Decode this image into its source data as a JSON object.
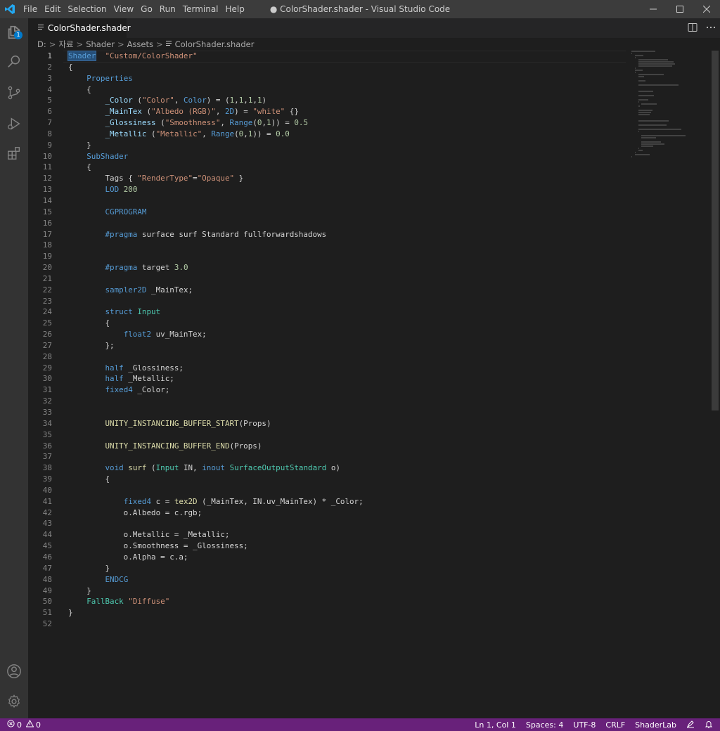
{
  "app": {
    "window_title": "● ColorShader.shader - Visual Studio Code"
  },
  "menu": [
    "File",
    "Edit",
    "Selection",
    "View",
    "Go",
    "Run",
    "Terminal",
    "Help"
  ],
  "activity": {
    "explorer_badge": "1"
  },
  "tab": {
    "label": "ColorShader.shader",
    "modified": true
  },
  "breadcrumb": [
    "D:",
    "자료",
    "Shader",
    "Assets",
    "ColorShader.shader"
  ],
  "editor": {
    "active_line": 1,
    "lines": [
      [
        [
          "sel kw",
          "Shader"
        ],
        [
          "",
          "  "
        ],
        [
          "st",
          "\"Custom/ColorShader\""
        ]
      ],
      [
        [
          "",
          "{"
        ]
      ],
      [
        [
          "",
          "    "
        ],
        [
          "kw",
          "Properties"
        ]
      ],
      [
        [
          "",
          "    {"
        ]
      ],
      [
        [
          "",
          "        "
        ],
        [
          "va",
          "_Color"
        ],
        [
          "",
          " ("
        ],
        [
          "st",
          "\"Color\""
        ],
        [
          "",
          ", "
        ],
        [
          "kw",
          "Color"
        ],
        [
          "",
          ") = ("
        ],
        [
          "nu",
          "1"
        ],
        [
          "",
          ","
        ],
        [
          "nu",
          "1"
        ],
        [
          "",
          ","
        ],
        [
          "nu",
          "1"
        ],
        [
          "",
          ","
        ],
        [
          "nu",
          "1"
        ],
        [
          "",
          ")"
        ]
      ],
      [
        [
          "",
          "        "
        ],
        [
          "va",
          "_MainTex"
        ],
        [
          "",
          " ("
        ],
        [
          "st",
          "\"Albedo (RGB)\""
        ],
        [
          "",
          ", "
        ],
        [
          "kw",
          "2D"
        ],
        [
          "",
          ") = "
        ],
        [
          "st",
          "\"white\""
        ],
        [
          "",
          " {}"
        ]
      ],
      [
        [
          "",
          "        "
        ],
        [
          "va",
          "_Glossiness"
        ],
        [
          "",
          " ("
        ],
        [
          "st",
          "\"Smoothness\""
        ],
        [
          "",
          ", "
        ],
        [
          "kw",
          "Range"
        ],
        [
          "",
          "("
        ],
        [
          "nu",
          "0"
        ],
        [
          "",
          ","
        ],
        [
          "nu",
          "1"
        ],
        [
          "",
          ")) = "
        ],
        [
          "nu",
          "0.5"
        ]
      ],
      [
        [
          "",
          "        "
        ],
        [
          "va",
          "_Metallic"
        ],
        [
          "",
          " ("
        ],
        [
          "st",
          "\"Metallic\""
        ],
        [
          "",
          ", "
        ],
        [
          "kw",
          "Range"
        ],
        [
          "",
          "("
        ],
        [
          "nu",
          "0"
        ],
        [
          "",
          ","
        ],
        [
          "nu",
          "1"
        ],
        [
          "",
          ")) = "
        ],
        [
          "nu",
          "0.0"
        ]
      ],
      [
        [
          "",
          "    }"
        ]
      ],
      [
        [
          "",
          "    "
        ],
        [
          "kw",
          "SubShader"
        ]
      ],
      [
        [
          "",
          "    {"
        ]
      ],
      [
        [
          "",
          "        Tags { "
        ],
        [
          "st",
          "\"RenderType\""
        ],
        [
          "",
          "="
        ],
        [
          "st",
          "\"Opaque\""
        ],
        [
          "",
          " }"
        ]
      ],
      [
        [
          "",
          "        "
        ],
        [
          "kw",
          "LOD"
        ],
        [
          "",
          " "
        ],
        [
          "nu",
          "200"
        ]
      ],
      [
        [
          "",
          ""
        ]
      ],
      [
        [
          "",
          "        "
        ],
        [
          "kw",
          "CGPROGRAM"
        ]
      ],
      [
        [
          "",
          ""
        ]
      ],
      [
        [
          "",
          "        "
        ],
        [
          "kw",
          "#pragma"
        ],
        [
          "",
          " surface surf Standard fullforwardshadows"
        ]
      ],
      [
        [
          "",
          ""
        ]
      ],
      [
        [
          "",
          ""
        ]
      ],
      [
        [
          "",
          "        "
        ],
        [
          "kw",
          "#pragma"
        ],
        [
          "",
          " target "
        ],
        [
          "nu",
          "3.0"
        ]
      ],
      [
        [
          "",
          ""
        ]
      ],
      [
        [
          "",
          "        "
        ],
        [
          "kw",
          "sampler2D"
        ],
        [
          "",
          " _MainTex;"
        ]
      ],
      [
        [
          "",
          ""
        ]
      ],
      [
        [
          "",
          "        "
        ],
        [
          "kw",
          "struct"
        ],
        [
          "",
          " "
        ],
        [
          "ty",
          "Input"
        ]
      ],
      [
        [
          "",
          "        {"
        ]
      ],
      [
        [
          "",
          "            "
        ],
        [
          "kw",
          "float2"
        ],
        [
          "",
          " uv_MainTex;"
        ]
      ],
      [
        [
          "",
          "        };"
        ]
      ],
      [
        [
          "",
          ""
        ]
      ],
      [
        [
          "",
          "        "
        ],
        [
          "kw",
          "half"
        ],
        [
          "",
          " _Glossiness;"
        ]
      ],
      [
        [
          "",
          "        "
        ],
        [
          "kw",
          "half"
        ],
        [
          "",
          " _Metallic;"
        ]
      ],
      [
        [
          "",
          "        "
        ],
        [
          "kw",
          "fixed4"
        ],
        [
          "",
          " _Color;"
        ]
      ],
      [
        [
          "",
          ""
        ]
      ],
      [
        [
          "",
          ""
        ]
      ],
      [
        [
          "",
          "        "
        ],
        [
          "fn",
          "UNITY_INSTANCING_BUFFER_START"
        ],
        [
          "",
          "(Props)"
        ]
      ],
      [
        [
          "",
          ""
        ]
      ],
      [
        [
          "",
          "        "
        ],
        [
          "fn",
          "UNITY_INSTANCING_BUFFER_END"
        ],
        [
          "",
          "(Props)"
        ]
      ],
      [
        [
          "",
          ""
        ]
      ],
      [
        [
          "",
          "        "
        ],
        [
          "kw",
          "void"
        ],
        [
          "",
          " "
        ],
        [
          "fn",
          "surf"
        ],
        [
          "",
          " ("
        ],
        [
          "ty",
          "Input"
        ],
        [
          "",
          " IN, "
        ],
        [
          "kw",
          "inout"
        ],
        [
          "",
          " "
        ],
        [
          "ty",
          "SurfaceOutputStandard"
        ],
        [
          "",
          " o)"
        ]
      ],
      [
        [
          "",
          "        {"
        ]
      ],
      [
        [
          "",
          ""
        ]
      ],
      [
        [
          "",
          "            "
        ],
        [
          "kw",
          "fixed4"
        ],
        [
          "",
          " c = "
        ],
        [
          "fn",
          "tex2D"
        ],
        [
          "",
          " (_MainTex, IN.uv_MainTex) * _Color;"
        ]
      ],
      [
        [
          "",
          "            o.Albedo = c.rgb;"
        ]
      ],
      [
        [
          "",
          ""
        ]
      ],
      [
        [
          "",
          "            o.Metallic = _Metallic;"
        ]
      ],
      [
        [
          "",
          "            o.Smoothness = _Glossiness;"
        ]
      ],
      [
        [
          "",
          "            o.Alpha = c.a;"
        ]
      ],
      [
        [
          "",
          "        }"
        ]
      ],
      [
        [
          "",
          "        "
        ],
        [
          "kw",
          "ENDCG"
        ]
      ],
      [
        [
          "",
          "    }"
        ]
      ],
      [
        [
          "",
          "    "
        ],
        [
          "ty",
          "FallBack"
        ],
        [
          "",
          " "
        ],
        [
          "st",
          "\"Diffuse\""
        ]
      ],
      [
        [
          "",
          "}"
        ]
      ],
      [
        [
          "",
          ""
        ]
      ]
    ]
  },
  "status": {
    "errors": "0",
    "warnings": "0",
    "position": "Ln 1, Col 1",
    "spaces": "Spaces: 4",
    "encoding": "UTF-8",
    "eol": "CRLF",
    "language": "ShaderLab"
  },
  "colors": {
    "statusbar": "#68217a",
    "accent": "#007acc"
  }
}
